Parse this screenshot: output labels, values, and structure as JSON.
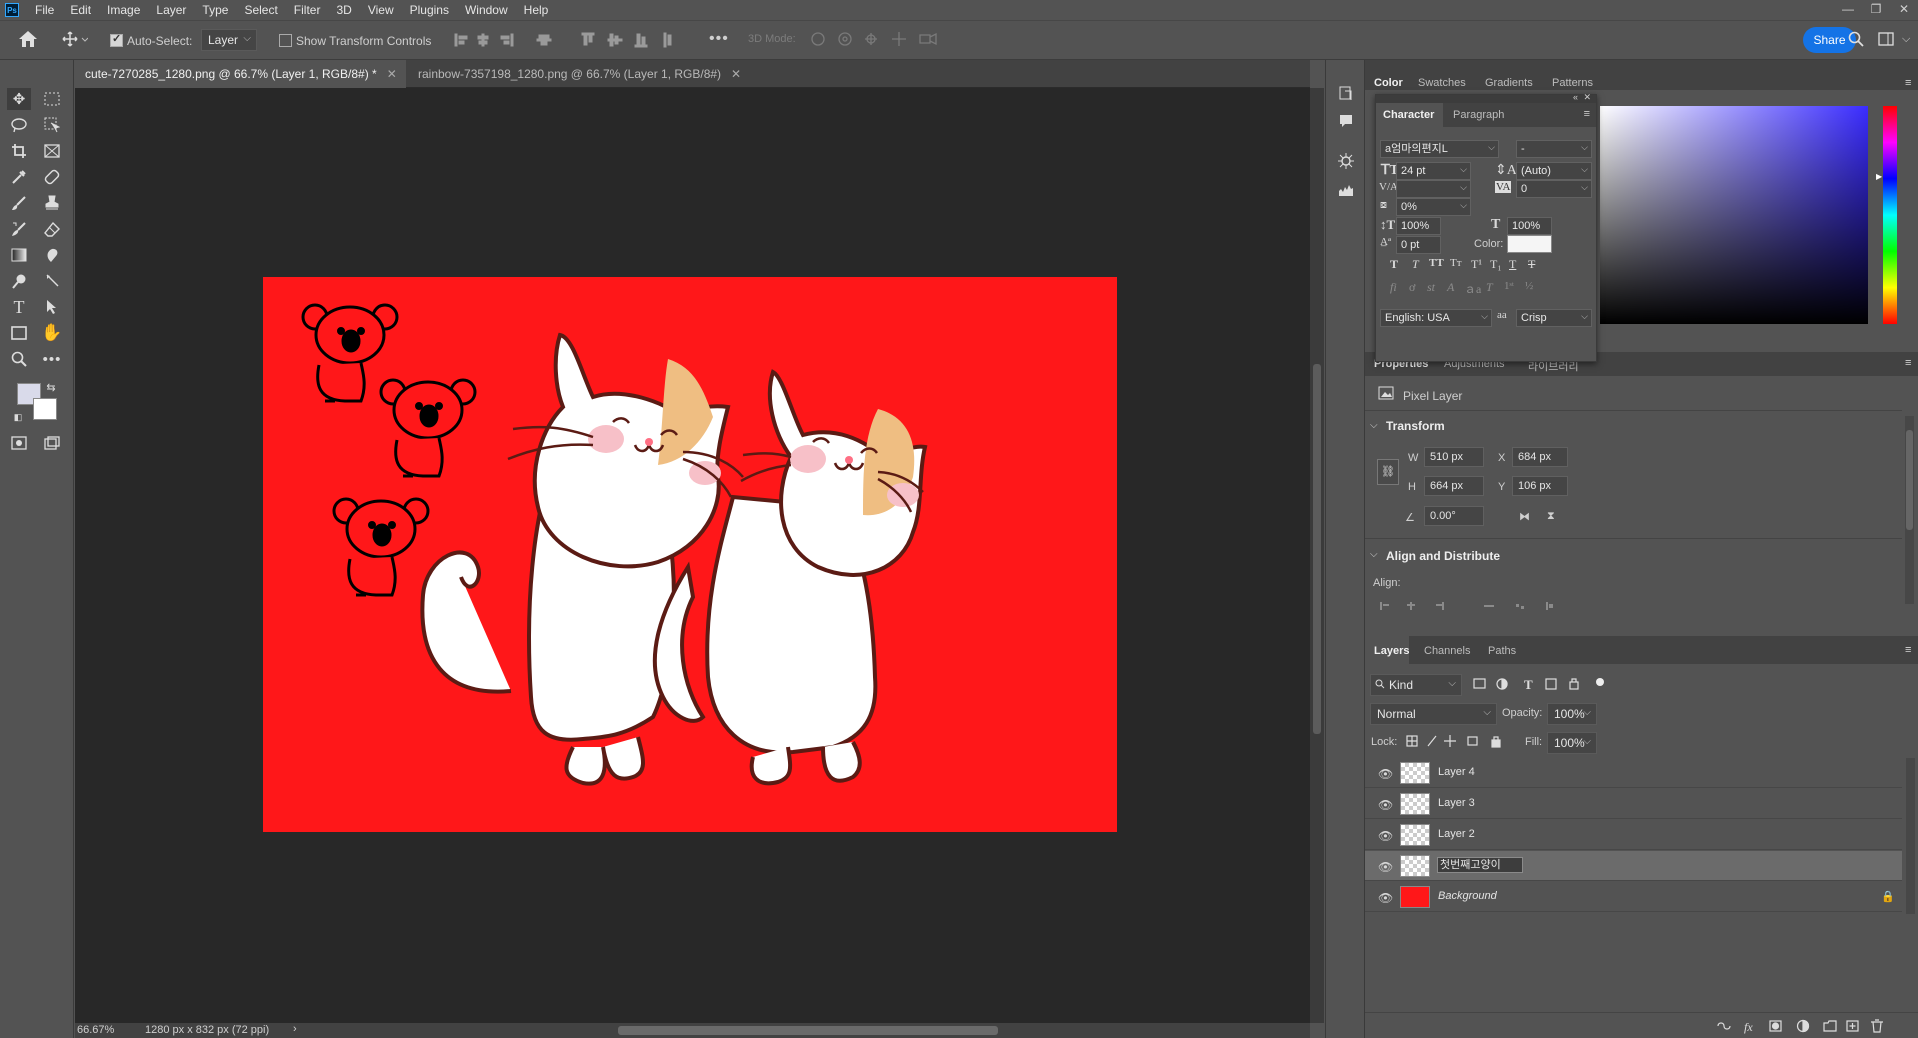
{
  "app": {
    "logo": "Ps"
  },
  "menu": [
    "File",
    "Edit",
    "Image",
    "Layer",
    "Type",
    "Select",
    "Filter",
    "3D",
    "View",
    "Plugins",
    "Window",
    "Help"
  ],
  "options": {
    "auto_select_label": "Auto-Select:",
    "auto_select_checked": true,
    "auto_select_target": "Layer",
    "transform_label": "Show Transform Controls",
    "transform_checked": false,
    "mode_3d_label": "3D Mode:",
    "share_label": "Share"
  },
  "tabs": [
    {
      "label": "cute-7270285_1280.png @ 66.7% (Layer 1, RGB/8#) *",
      "active": true
    },
    {
      "label": "rainbow-7357198_1280.png @ 66.7% (Layer 1, RGB/8#)",
      "active": false
    }
  ],
  "status": {
    "zoom": "66.67%",
    "doc_size": "1280 px x 832 px (72 ppi)"
  },
  "canvas": {
    "background_color": "#ff1719"
  },
  "color_panel": {
    "tabs": [
      "Color",
      "Swatches",
      "Gradients",
      "Patterns"
    ]
  },
  "character": {
    "tabs": [
      "Character",
      "Paragraph"
    ],
    "font_family": "a엄마의편지L",
    "font_style": "-",
    "font_size": "24 pt",
    "leading": "(Auto)",
    "kerning": "",
    "tracking": "0",
    "tsume": "0%",
    "vertical_scale": "100%",
    "horizontal_scale": "100%",
    "baseline_shift": "0 pt",
    "color_label": "Color:",
    "color_value": "#f5f5f5",
    "language": "English: USA",
    "aa_label": "aa",
    "antialias": "Crisp"
  },
  "properties": {
    "tabs": [
      "Properties",
      "Adjustments",
      "라이브러리"
    ],
    "layer_type": "Pixel Layer",
    "transform_title": "Transform",
    "w_label": "W",
    "w_value": "510 px",
    "x_label": "X",
    "x_value": "684 px",
    "h_label": "H",
    "h_value": "664 px",
    "y_label": "Y",
    "y_value": "106 px",
    "angle_value": "0.00°",
    "align_title": "Align and Distribute",
    "align_label": "Align:"
  },
  "layers_panel": {
    "tabs": [
      "Layers",
      "Channels",
      "Paths"
    ],
    "filter_kind": "Kind",
    "blend_mode": "Normal",
    "opacity_label": "Opacity:",
    "opacity_value": "100%",
    "lock_label": "Lock:",
    "fill_label": "Fill:",
    "fill_value": "100%",
    "layers": [
      {
        "name": "Layer 4",
        "selected": false
      },
      {
        "name": "Layer 3",
        "selected": false
      },
      {
        "name": "Layer 2",
        "selected": false
      },
      {
        "name": "첫번째고양이",
        "selected": true
      },
      {
        "name": "Background",
        "selected": false,
        "locked": true
      }
    ]
  }
}
